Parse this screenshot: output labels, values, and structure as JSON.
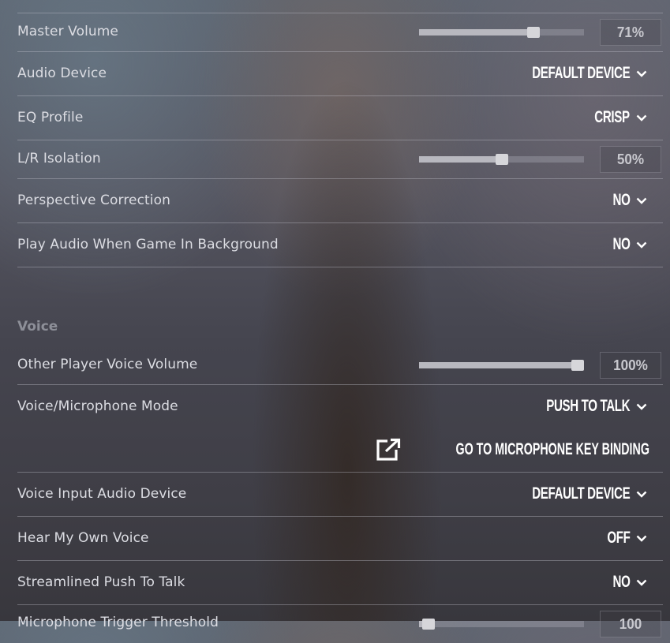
{
  "audio": {
    "master_volume": {
      "label": "Master Volume",
      "value_pct": 71,
      "display": "71%"
    },
    "audio_device": {
      "label": "Audio Device",
      "value": "DEFAULT DEVICE"
    },
    "eq_profile": {
      "label": "EQ Profile",
      "value": "CRISP"
    },
    "lr_isolation": {
      "label": "L/R Isolation",
      "value_pct": 50,
      "display": "50%"
    },
    "perspective_correction": {
      "label": "Perspective Correction",
      "value": "NO"
    },
    "play_in_background": {
      "label": "Play Audio When Game In Background",
      "value": "NO"
    }
  },
  "voice": {
    "section_title": "Voice",
    "other_player_volume": {
      "label": "Other Player Voice Volume",
      "value_pct": 100,
      "display": "100%"
    },
    "mic_mode": {
      "label": "Voice/Microphone Mode",
      "value": "PUSH TO TALK"
    },
    "key_binding_link": {
      "label": "GO TO MICROPHONE KEY BINDING",
      "icon": "external-link-icon"
    },
    "input_device": {
      "label": "Voice Input Audio Device",
      "value": "DEFAULT DEVICE"
    },
    "hear_own_voice": {
      "label": "Hear My Own Voice",
      "value": "OFF"
    },
    "streamlined_ptt": {
      "label": "Streamlined Push To Talk",
      "value": "NO"
    },
    "mic_trigger_threshold": {
      "label": "Microphone Trigger Threshold",
      "value_pct": 2,
      "display": "100"
    }
  },
  "icons": {
    "dropdown": "chevron-down-icon"
  },
  "colors": {
    "value_text": "#ffffff",
    "label_text": "#dcdde3",
    "section_text": "#8d8f98",
    "slider_fill": "#b8b8bf"
  }
}
